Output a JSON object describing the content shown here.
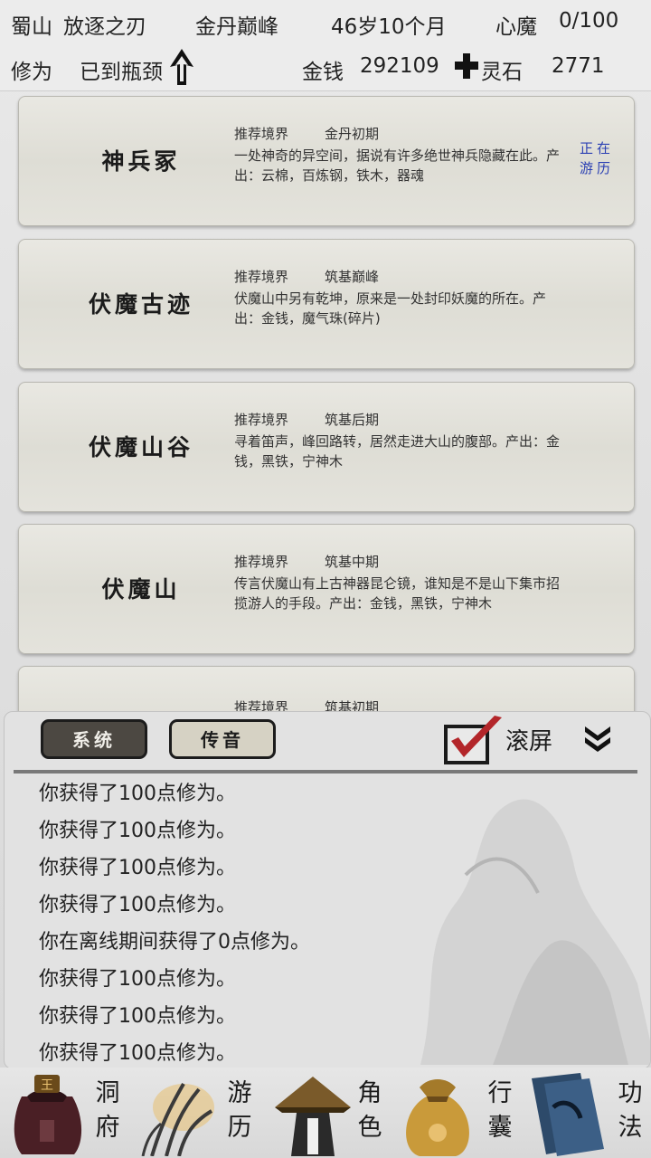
{
  "header": {
    "sect": "蜀山",
    "title": "放逐之刃",
    "realm": "金丹巅峰",
    "age": "46岁10个月",
    "xinmo_label": "心魔",
    "xinmo_value": "0/100",
    "xiuwei_label": "修为",
    "xiuwei_value": "已到瓶颈",
    "money_label": "金钱",
    "money_value": "292109",
    "lingshi_label": "灵石",
    "lingshi_value": "2771"
  },
  "cards": [
    {
      "name": "神兵冢",
      "rec_label": "推荐境界",
      "rec_value": "金丹初期",
      "desc": "一处神奇的异空间，据说有许多绝世神兵隐藏在此。产出：云棉，百炼钢，铁木，器魂",
      "status": "正在游历"
    },
    {
      "name": "伏魔古迹",
      "rec_label": "推荐境界",
      "rec_value": "筑基巅峰",
      "desc": "伏魔山中另有乾坤，原来是一处封印妖魔的所在。产出：金钱，魔气珠(碎片)"
    },
    {
      "name": "伏魔山谷",
      "rec_label": "推荐境界",
      "rec_value": "筑基后期",
      "desc": "寻着笛声，峰回路转，居然走进大山的腹部。产出：金钱，黑铁，宁神木"
    },
    {
      "name": "伏魔山",
      "rec_label": "推荐境界",
      "rec_value": "筑基中期",
      "desc": "传言伏魔山有上古神器昆仑镜，谁知是不是山下集市招揽游人的手段。产出：金钱，黑铁，宁神木"
    },
    {
      "rec_label": "推荐境界",
      "rec_value": "筑基初期"
    }
  ],
  "panel": {
    "tab_system": "系统",
    "tab_voice": "传音",
    "scroll_label": "滚屏",
    "logs": [
      "你获得了100点修为。",
      "你获得了100点修为。",
      "你获得了100点修为。",
      "你获得了100点修为。",
      "你在离线期间获得了0点修为。",
      "你获得了100点修为。",
      "你获得了100点修为。",
      "你获得了100点修为。"
    ]
  },
  "nav": {
    "dongfu": [
      "洞",
      "府"
    ],
    "youli": [
      "游",
      "历"
    ],
    "juese": [
      "角",
      "色"
    ],
    "xingnang": [
      "行",
      "囊"
    ],
    "gongfa": [
      "功",
      "法"
    ]
  },
  "colors": {
    "status_text": "#2a3fb3",
    "check_mark": "#b3262a",
    "active_tab": "#4c4842",
    "youli_highlight": "#e8c070"
  }
}
